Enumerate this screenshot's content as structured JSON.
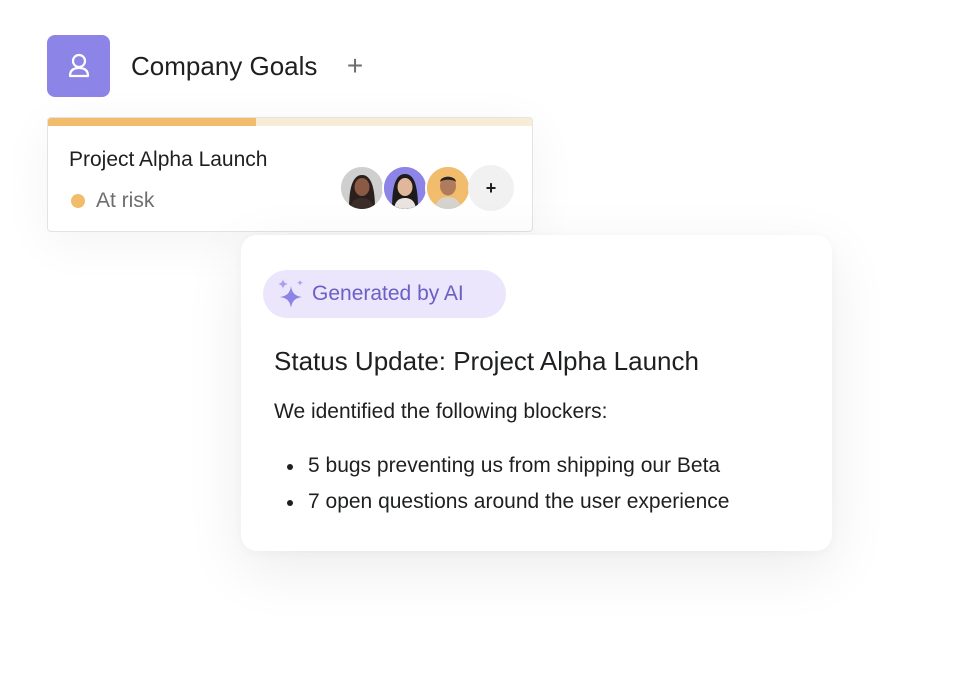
{
  "header": {
    "title": "Company Goals",
    "add_label": "+",
    "goal_icon": "goal-person-icon"
  },
  "project_card": {
    "name": "Project Alpha Launch",
    "status": "At risk",
    "status_color": "#f1bd6c",
    "progress": 0.43,
    "avatars": [
      {
        "name": "avatar-woman-1",
        "ring": "#d9d9d9"
      },
      {
        "name": "avatar-woman-2",
        "ring": "#8d84e8"
      },
      {
        "name": "avatar-man",
        "ring": "#f1bd6c"
      }
    ],
    "add_member_label": "+"
  },
  "ai_card": {
    "badge_label": "Generated by AI",
    "badge_icon": "sparkle-icon",
    "title": "Status Update: Project Alpha Launch",
    "intro": "We identified the following blockers:",
    "blockers": [
      "5 bugs preventing us from shipping our Beta",
      "7 open questions around the user experience"
    ]
  },
  "colors": {
    "accent_purple": "#8d84e8",
    "warning_yellow": "#f1bd6c",
    "badge_bg": "#ebe6fb",
    "badge_text": "#6a5fc4"
  }
}
